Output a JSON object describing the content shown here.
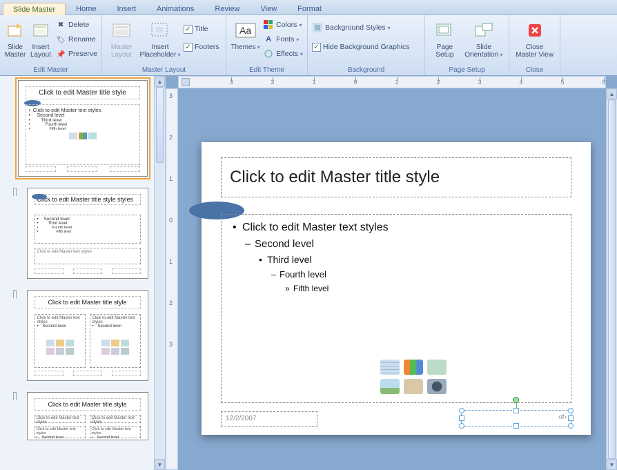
{
  "tabs": {
    "active": "Slide Master",
    "items": [
      "Slide Master",
      "Home",
      "Insert",
      "Animations",
      "Review",
      "View",
      "Format"
    ]
  },
  "ribbon": {
    "editMaster": {
      "label": "Edit Master",
      "slideMaster": "Slide\nMaster",
      "insertLayout": "Insert\nLayout",
      "delete": "Delete",
      "rename": "Rename",
      "preserve": "Preserve"
    },
    "masterLayout": {
      "label": "Master Layout",
      "masterLayoutBtn": "Master\nLayout",
      "insertPlaceholder": "Insert\nPlaceholder",
      "title": "Title",
      "footers": "Footers"
    },
    "editTheme": {
      "label": "Edit Theme",
      "themes": "Themes",
      "colors": "Colors",
      "fonts": "Fonts",
      "effects": "Effects"
    },
    "background": {
      "label": "Background",
      "bgStyles": "Background Styles",
      "hideBg": "Hide Background Graphics"
    },
    "pageSetup": {
      "label": "Page Setup",
      "pageSetupBtn": "Page\nSetup",
      "orientation": "Slide\nOrientation"
    },
    "close": {
      "label": "Close",
      "closeBtn": "Close\nMaster View"
    }
  },
  "thumbnails": [
    {
      "title": "Click to edit Master title style",
      "body": "Click to edit Master text styles",
      "lv2": "Second level",
      "lv3": "Third level",
      "lv4": "Fourth level",
      "lv5": "Fifth level",
      "selected": true,
      "ellipse": true,
      "icons": true
    },
    {
      "title": "Click to edit Master title style styles",
      "body": "",
      "lv2": "Second level",
      "lv3": "Third level",
      "lv4": "Fourth level",
      "lv5": "Fifth level",
      "selected": false,
      "ellipse": true,
      "caption": "Click to edit Master text styles"
    },
    {
      "title": "Click to edit Master title style",
      "twoCol": true,
      "colText": "Click to edit Master text styles",
      "lv2": "Second level"
    },
    {
      "title": "Click to edit Master title style",
      "twoCol": true,
      "header": "Click to edit Master text styles",
      "colText": "Click to edit Master text styles",
      "lv2": "Second level",
      "short": true
    }
  ],
  "slide": {
    "titlePlaceholder": "Click to edit Master title style",
    "lv1": "Click to edit Master text styles",
    "lv2": "Second level",
    "lv3": "Third level",
    "lv4": "Fourth level",
    "lv5": "Fifth level",
    "date": "12/2/2007",
    "slideNum": "‹#›"
  },
  "rulerH": [
    -3,
    -2,
    -1,
    0,
    1,
    2,
    3,
    4,
    5,
    6
  ],
  "rulerV": [
    -3,
    -2,
    -1,
    0,
    1,
    2,
    3
  ],
  "colors": {
    "accent": "#4a73a8"
  }
}
